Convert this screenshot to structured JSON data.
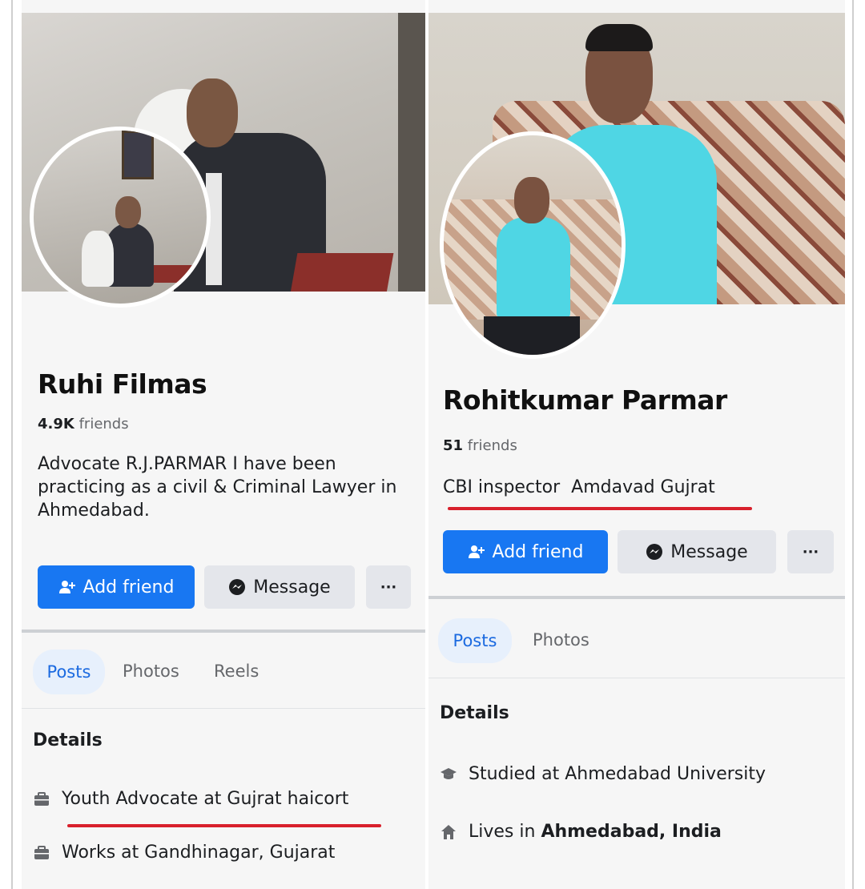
{
  "left_profile": {
    "name": "Ruhi Filmas",
    "friends_count": "4.9K",
    "friends_label": "friends",
    "bio": "Advocate R.J.PARMAR I have been practicing as a civil & Criminal Lawyer in Ahmedabad.",
    "add_friend_label": "Add friend",
    "message_label": "Message",
    "more_label": "···",
    "tabs": [
      "Posts",
      "Photos",
      "Reels"
    ],
    "details_heading": "Details",
    "details": [
      {
        "icon": "briefcase-icon",
        "text": "Youth Advocate at Gujrat haicort"
      },
      {
        "icon": "briefcase-icon",
        "text": "Works at Gandhinagar, Gujarat"
      }
    ]
  },
  "right_profile": {
    "name": "Rohitkumar Parmar",
    "friends_count": "51",
    "friends_label": "friends",
    "bio": "CBI inspector  Amdavad Gujrat",
    "add_friend_label": "Add friend",
    "message_label": "Message",
    "more_label": "···",
    "tabs": [
      "Posts",
      "Photos"
    ],
    "details_heading": "Details",
    "details": [
      {
        "icon": "graduation-cap-icon",
        "text": "Studied at Ahmedabad University"
      },
      {
        "icon": "home-icon",
        "text_prefix": "Lives in ",
        "text_bold": "Ahmedabad, India"
      }
    ]
  },
  "colors": {
    "accent_blue": "#1877f2",
    "highlight_red": "#d8202c",
    "tab_active_bg": "#e7f0fc"
  }
}
